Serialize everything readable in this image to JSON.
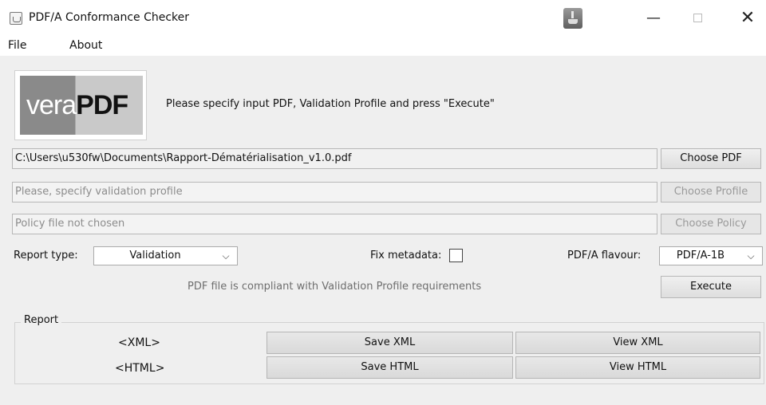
{
  "window": {
    "title": "PDF/A Conformance Checker",
    "minimize_glyph": "—",
    "close_glyph": "✕"
  },
  "menu": {
    "file": "File",
    "about": "About"
  },
  "logo": {
    "vera": "vera",
    "pdf": "PDF"
  },
  "instruction": "Please specify input PDF, Validation Profile and press \"Execute\"",
  "inputs": {
    "pdf_path": "C:\\Users\\u530fw\\Documents\\Rapport-Dématérialisation_v1.0.pdf",
    "profile_placeholder": "Please, specify validation profile",
    "policy_placeholder": "Policy file not chosen"
  },
  "buttons": {
    "choose_pdf": "Choose PDF",
    "choose_profile": "Choose Profile",
    "choose_policy": "Choose Policy",
    "execute": "Execute"
  },
  "options": {
    "report_type_label": "Report type:",
    "report_type_value": "Validation",
    "fix_metadata_label": "Fix metadata:",
    "fix_metadata_checked": false,
    "flavour_label": "PDF/A flavour:",
    "flavour_value": "PDF/A-1B"
  },
  "status": "PDF file is compliant with Validation Profile requirements",
  "report": {
    "legend": "Report",
    "xml_label": "<XML>",
    "html_label": "<HTML>",
    "save_xml": "Save XML",
    "view_xml": "View XML",
    "save_html": "Save HTML",
    "view_html": "View HTML"
  }
}
